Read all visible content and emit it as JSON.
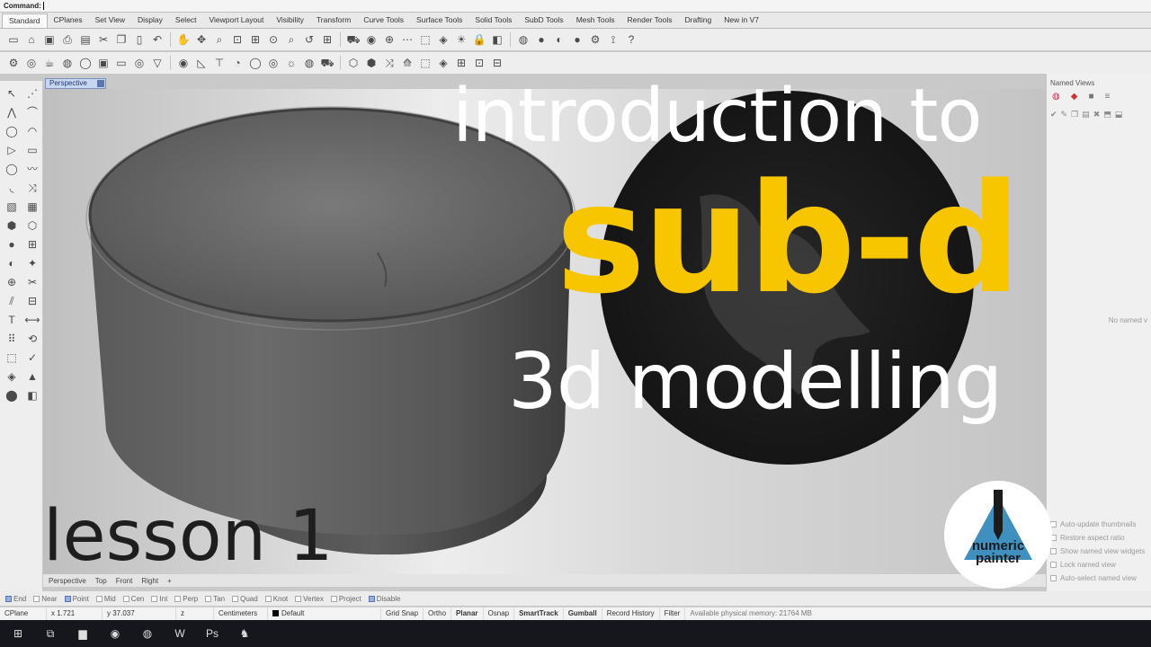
{
  "command": {
    "label": "Command:"
  },
  "tabs": [
    "Standard",
    "CPlanes",
    "Set View",
    "Display",
    "Select",
    "Viewport Layout",
    "Visibility",
    "Transform",
    "Curve Tools",
    "Surface Tools",
    "Solid Tools",
    "SubD Tools",
    "Mesh Tools",
    "Render Tools",
    "Drafting",
    "New in V7"
  ],
  "toolbar_row1_icons": [
    {
      "name": "new-file-icon",
      "glyph": "▭"
    },
    {
      "name": "open-file-icon",
      "glyph": "⌂"
    },
    {
      "name": "save-icon",
      "glyph": "▣"
    },
    {
      "name": "print-icon",
      "glyph": "⎙"
    },
    {
      "name": "properties-icon",
      "glyph": "▤"
    },
    {
      "name": "cut-icon",
      "glyph": "✂"
    },
    {
      "name": "copy-icon",
      "glyph": "❐"
    },
    {
      "name": "paste-icon",
      "glyph": "▯"
    },
    {
      "name": "undo-icon",
      "glyph": "↶"
    },
    {
      "name": "pan-icon",
      "glyph": "✋"
    },
    {
      "name": "rotate-view-icon",
      "glyph": "✥"
    },
    {
      "name": "zoom-icon",
      "glyph": "⌕"
    },
    {
      "name": "zoom-window-icon",
      "glyph": "⊡"
    },
    {
      "name": "zoom-extents-icon",
      "glyph": "⊞"
    },
    {
      "name": "zoom-selected-icon",
      "glyph": "⊙"
    },
    {
      "name": "zoom-dynamic-icon",
      "glyph": "⌕"
    },
    {
      "name": "undo-view-icon",
      "glyph": "↺"
    },
    {
      "name": "four-view-icon",
      "glyph": "⊞"
    },
    {
      "name": "car-icon",
      "glyph": "⛟"
    },
    {
      "name": "named-view-icon",
      "glyph": "◉"
    },
    {
      "name": "cplane-icon",
      "glyph": "⊕"
    },
    {
      "name": "grid-icon",
      "glyph": "⋯"
    },
    {
      "name": "select-icon",
      "glyph": "⬚"
    },
    {
      "name": "layer-icon",
      "glyph": "◈"
    },
    {
      "name": "lights-icon",
      "glyph": "☀"
    },
    {
      "name": "lock-icon",
      "glyph": "🔒"
    },
    {
      "name": "object-props-icon",
      "glyph": "◧"
    },
    {
      "name": "color-wheel-icon",
      "glyph": "◍"
    },
    {
      "name": "render-sphere-icon",
      "glyph": "●"
    },
    {
      "name": "render-preview-icon",
      "glyph": "◐"
    },
    {
      "name": "material-sphere-icon",
      "glyph": "●"
    },
    {
      "name": "options-icon",
      "glyph": "⚙"
    },
    {
      "name": "snap-icon",
      "glyph": "⟟"
    },
    {
      "name": "help-icon",
      "glyph": "?"
    }
  ],
  "toolbar_row2_icons": [
    {
      "name": "subd-toggle-icon",
      "glyph": "⚙"
    },
    {
      "name": "subd-mode-icon",
      "glyph": "◎"
    },
    {
      "name": "subd-teapot-icon",
      "glyph": "☕"
    },
    {
      "name": "subd-sphere-icon",
      "glyph": "◍"
    },
    {
      "name": "subd-torus-icon",
      "glyph": "◯"
    },
    {
      "name": "subd-box-icon",
      "glyph": "▣"
    },
    {
      "name": "subd-plane-icon",
      "glyph": "▭"
    },
    {
      "name": "subd-ring-icon",
      "glyph": "◎"
    },
    {
      "name": "subd-cone-icon",
      "glyph": "▽"
    },
    {
      "name": "subd-disk-icon",
      "glyph": "◉"
    },
    {
      "name": "subd-triangle-icon",
      "glyph": "◺"
    },
    {
      "name": "subd-tee-icon",
      "glyph": "⊤"
    },
    {
      "name": "subd-ellipsoid-icon",
      "glyph": "◔"
    },
    {
      "name": "subd-torus-b-icon",
      "glyph": "◯"
    },
    {
      "name": "subd-target-icon",
      "glyph": "◎"
    },
    {
      "name": "subd-sun-icon",
      "glyph": "☼"
    },
    {
      "name": "subd-sphere-b-icon",
      "glyph": "◍"
    },
    {
      "name": "subd-car-icon",
      "glyph": "⛟"
    },
    {
      "name": "subd-cube-icon",
      "glyph": "⬡"
    },
    {
      "name": "subd-cube-b-icon",
      "glyph": "⬢"
    },
    {
      "name": "subd-sweep-icon",
      "glyph": "⤨"
    },
    {
      "name": "subd-loft-icon",
      "glyph": "⟰"
    },
    {
      "name": "subd-pipe-icon",
      "glyph": "⬚"
    },
    {
      "name": "subd-skin-icon",
      "glyph": "◈"
    },
    {
      "name": "subd-bridge-icon",
      "glyph": "⊞"
    },
    {
      "name": "subd-crease-icon",
      "glyph": "⊡"
    },
    {
      "name": "subd-lock-icon",
      "glyph": "⊟"
    }
  ],
  "left_toolbar_icons": [
    "select-points-icon",
    "line-icon",
    "polyline-icon",
    "curve-icon",
    "circle-icon",
    "arc-icon",
    "triangle-icon",
    "rectangle-icon",
    "ellipse-icon",
    "freeform-icon",
    "fillet-icon",
    "offset-icon",
    "surface-icon",
    "extrude-icon",
    "box-icon",
    "cylinder-icon",
    "sphere-icon",
    "mesh-icon",
    "boolean-icon",
    "explode-icon",
    "join-icon",
    "trim-icon",
    "split-icon",
    "group-icon",
    "text-icon",
    "dimension-icon",
    "array-icon",
    "transform-icon",
    "solid-tools-icon",
    "check-icon",
    "analyze-icon",
    "render-icon",
    "paint-icon",
    "layers-icon"
  ],
  "left_toolbar_glyphs": [
    "↖",
    "⋰",
    "⋀",
    "⌒",
    "◯",
    "◠",
    "▷",
    "▭",
    "◯",
    "〰",
    "◟",
    "⤨",
    "▧",
    "▦",
    "⬢",
    "⬡",
    "●",
    "⊞",
    "◐",
    "✦",
    "⊕",
    "✂",
    "⫽",
    "⊟",
    "T",
    "⟷",
    "⠿",
    "⟲",
    "⬚",
    "✓",
    "◈",
    "▲",
    "⬤",
    "◧"
  ],
  "viewport": {
    "label": "Perspective"
  },
  "viewport_tabs": [
    "Perspective",
    "Top",
    "Front",
    "Right",
    "+"
  ],
  "named_views": {
    "title": "Named Views",
    "empty_text": "No named v",
    "options": [
      {
        "label": "Auto-update thumbnails",
        "checked": false
      },
      {
        "label": "Restore aspect ratio",
        "checked": false
      },
      {
        "label": "Show named view widgets",
        "checked": false
      },
      {
        "label": "Lock named view",
        "checked": false
      },
      {
        "label": "Auto-select named view",
        "checked": false
      }
    ]
  },
  "osnaps": [
    {
      "label": "End",
      "on": true
    },
    {
      "label": "Near",
      "on": false
    },
    {
      "label": "Point",
      "on": true
    },
    {
      "label": "Mid",
      "on": false
    },
    {
      "label": "Cen",
      "on": false
    },
    {
      "label": "Int",
      "on": false
    },
    {
      "label": "Perp",
      "on": false
    },
    {
      "label": "Tan",
      "on": false
    },
    {
      "label": "Quad",
      "on": false
    },
    {
      "label": "Knot",
      "on": false
    },
    {
      "label": "Vertex",
      "on": false
    },
    {
      "label": "Project",
      "on": false
    },
    {
      "label": "Disable",
      "on": true
    }
  ],
  "status": {
    "cplane": "CPlane",
    "x": "x 1.721",
    "y": "y 37.037",
    "z": "z",
    "units": "Centimeters",
    "layer": "Default",
    "toggles": [
      {
        "label": "Grid Snap",
        "bold": false
      },
      {
        "label": "Ortho",
        "bold": false
      },
      {
        "label": "Planar",
        "bold": true
      },
      {
        "label": "Osnap",
        "bold": false
      },
      {
        "label": "SmartTrack",
        "bold": true
      },
      {
        "label": "Gumball",
        "bold": true
      },
      {
        "label": "Record History",
        "bold": false
      },
      {
        "label": "Filter",
        "bold": false
      }
    ],
    "memory": "Available physical memory: 21764 MB"
  },
  "taskbar": [
    {
      "name": "windows-start-icon",
      "glyph": "⊞"
    },
    {
      "name": "task-view-icon",
      "glyph": "⧉"
    },
    {
      "name": "file-explorer-icon",
      "glyph": "▆"
    },
    {
      "name": "chrome-icon",
      "glyph": "◉"
    },
    {
      "name": "spotify-icon",
      "glyph": "◍"
    },
    {
      "name": "word-icon",
      "glyph": "W"
    },
    {
      "name": "photoshop-icon",
      "glyph": "Ps"
    },
    {
      "name": "rhino-icon",
      "glyph": "♞"
    }
  ],
  "overlay": {
    "line1": "introduction to",
    "line2": "sub-d",
    "line3": "3d modelling",
    "lesson": "lesson 1",
    "logo_line1": "numeric",
    "logo_line2": "painter",
    "colors": {
      "accent": "#f7c600",
      "white": "#ffffff",
      "disc": "#1b1b1b",
      "logo_blue": "#3f8fbf"
    }
  }
}
